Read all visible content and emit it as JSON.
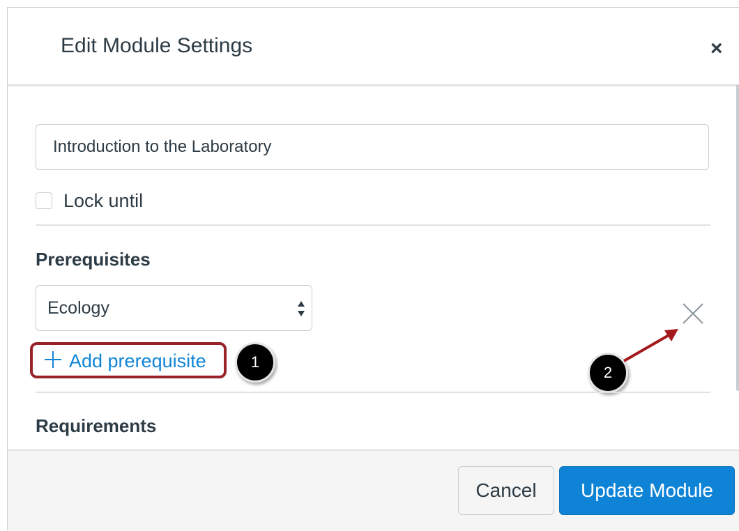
{
  "dialog": {
    "title": "Edit Module Settings",
    "close_glyph": "×"
  },
  "module_name": {
    "value": "Introduction to the Laboratory"
  },
  "lock": {
    "label": "Lock until",
    "checked": false
  },
  "prerequisites": {
    "heading": "Prerequisites",
    "selected": "Ecology",
    "add_label": "Add prerequisite",
    "add_icon": "plus-icon",
    "remove_icon": "close-icon"
  },
  "requirements": {
    "heading": "Requirements"
  },
  "callouts": [
    "1",
    "2"
  ],
  "footer": {
    "cancel_label": "Cancel",
    "update_label": "Update Module"
  },
  "colors": {
    "primary": "#0f84d7",
    "callout_border": "#98242a",
    "annotation_arrow": "#a3191c"
  }
}
